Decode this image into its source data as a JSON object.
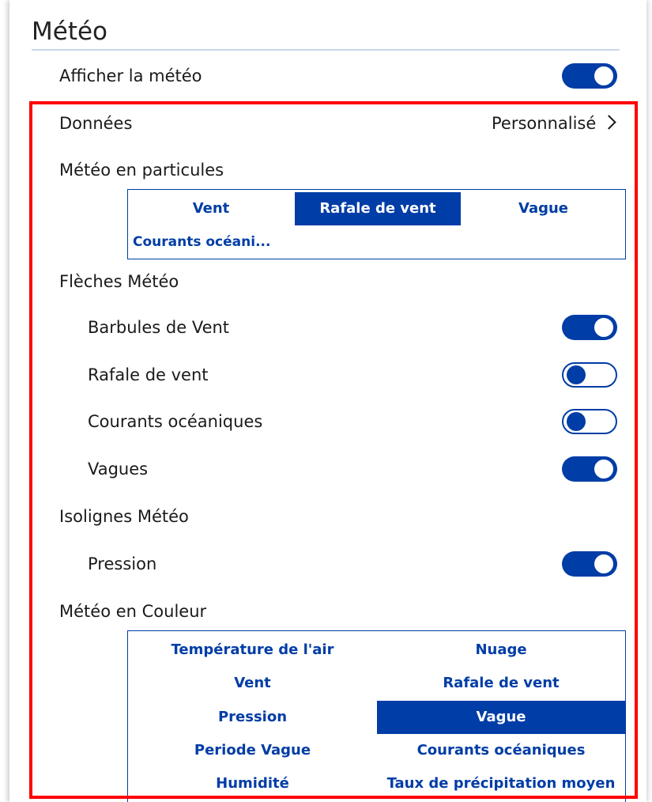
{
  "header": {
    "title": "Météo"
  },
  "show_weather": {
    "label": "Afficher la météo",
    "enabled": true
  },
  "data_row": {
    "label": "Données",
    "value": "Personnalisé",
    "icon": "chevron-right-icon"
  },
  "particles": {
    "label": "Météo en particules",
    "options": [
      "Vent",
      "Rafale de vent",
      "Vague",
      "Courants océani..."
    ],
    "selected": "Rafale de vent"
  },
  "arrows": {
    "label": "Flèches Météo",
    "items": [
      {
        "label": "Barbules de Vent",
        "enabled": true
      },
      {
        "label": "Rafale de vent",
        "enabled": false
      },
      {
        "label": "Courants océaniques",
        "enabled": false
      },
      {
        "label": "Vagues",
        "enabled": true
      }
    ]
  },
  "isolines": {
    "label": "Isolignes Météo",
    "items": [
      {
        "label": "Pression",
        "enabled": true
      }
    ]
  },
  "color": {
    "label": "Météo en Couleur",
    "options": [
      "Température de l'air",
      "Nuage",
      "Vent",
      "Rafale de vent",
      "Pression",
      "Vague",
      "Periode Vague",
      "Courants océaniques",
      "Humidité",
      "Taux de précipitation moyen"
    ],
    "selected": "Vague"
  },
  "colors": {
    "accent": "#003da6",
    "highlight_border": "#ff0000"
  }
}
